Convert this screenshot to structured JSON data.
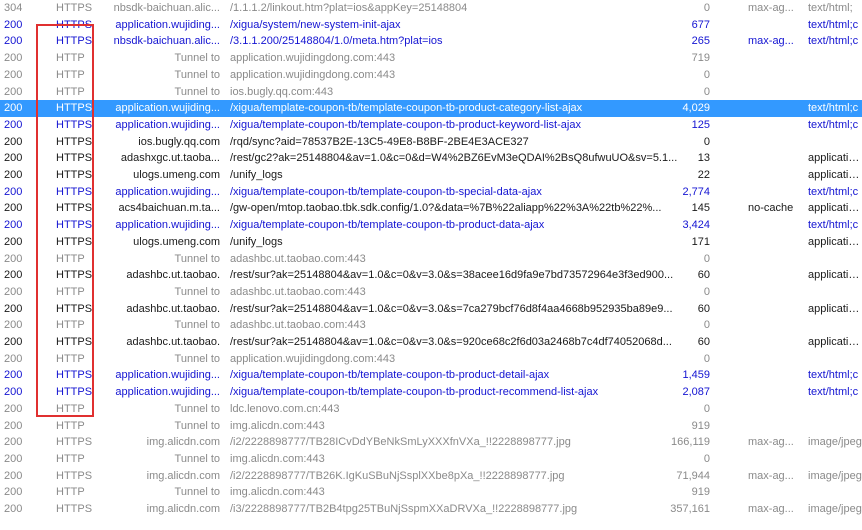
{
  "sessions": [
    {
      "result": "304",
      "protocol": "HTTPS",
      "host": "nbsdk-baichuan.alic...",
      "url": "/1.1.1.2/linkout.htm?plat=ios&appKey=25148804",
      "body": "0",
      "caching": "max-ag...",
      "content_type": "text/html;",
      "style": "gray"
    },
    {
      "result": "200",
      "protocol": "HTTPS",
      "host": "application.wujiding...",
      "url": "/xigua/system/new-system-init-ajax",
      "body": "677",
      "caching": "",
      "content_type": "text/html;c",
      "style": "blue"
    },
    {
      "result": "200",
      "protocol": "HTTPS",
      "host": "nbsdk-baichuan.alic...",
      "url": "/3.1.1.200/25148804/1.0/meta.htm?plat=ios",
      "body": "265",
      "caching": "max-ag...",
      "content_type": "text/html;c",
      "style": "blue"
    },
    {
      "result": "200",
      "protocol": "HTTP",
      "host": "Tunnel to",
      "url": "application.wujidingdong.com:443",
      "body": "719",
      "caching": "",
      "content_type": "",
      "style": "gray"
    },
    {
      "result": "200",
      "protocol": "HTTP",
      "host": "Tunnel to",
      "url": "application.wujidingdong.com:443",
      "body": "0",
      "caching": "",
      "content_type": "",
      "style": "gray"
    },
    {
      "result": "200",
      "protocol": "HTTP",
      "host": "Tunnel to",
      "url": "ios.bugly.qq.com:443",
      "body": "0",
      "caching": "",
      "content_type": "",
      "style": "gray"
    },
    {
      "result": "200",
      "protocol": "HTTPS",
      "host": "application.wujiding...",
      "url": "/xigua/template-coupon-tb/template-coupon-tb-product-category-list-ajax",
      "body": "4,029",
      "caching": "",
      "content_type": "text/html;c",
      "style": "selected"
    },
    {
      "result": "200",
      "protocol": "HTTPS",
      "host": "application.wujiding...",
      "url": "/xigua/template-coupon-tb/template-coupon-tb-product-keyword-list-ajax",
      "body": "125",
      "caching": "",
      "content_type": "text/html;c",
      "style": "blue"
    },
    {
      "result": "200",
      "protocol": "HTTPS",
      "host": "ios.bugly.qq.com",
      "url": "/rqd/sync?aid=78537B2E-13C5-49E8-B8BF-2BE4E3ACE327",
      "body": "0",
      "caching": "",
      "content_type": "",
      "style": "black"
    },
    {
      "result": "200",
      "protocol": "HTTPS",
      "host": "adashxgc.ut.taoba...",
      "url": "/rest/gc2?ak=25148804&av=1.0&c=0&d=W4%2BZ6EvM3eQDAI%2BsQ8ufwuUO&sv=5.1...",
      "body": "13",
      "caching": "",
      "content_type": "application/",
      "style": "black"
    },
    {
      "result": "200",
      "protocol": "HTTPS",
      "host": "ulogs.umeng.com",
      "url": "/unify_logs",
      "body": "22",
      "caching": "",
      "content_type": "application/",
      "style": "black"
    },
    {
      "result": "200",
      "protocol": "HTTPS",
      "host": "application.wujiding...",
      "url": "/xigua/template-coupon-tb/template-coupon-tb-special-data-ajax",
      "body": "2,774",
      "caching": "",
      "content_type": "text/html;c",
      "style": "blue"
    },
    {
      "result": "200",
      "protocol": "HTTPS",
      "host": "acs4baichuan.m.ta...",
      "url": "/gw-open/mtop.taobao.tbk.sdk.config/1.0?&data=%7B%22aliapp%22%3A%22tb%22%...",
      "body": "145",
      "caching": "no-cache",
      "content_type": "application/",
      "style": "black"
    },
    {
      "result": "200",
      "protocol": "HTTPS",
      "host": "application.wujiding...",
      "url": "/xigua/template-coupon-tb/template-coupon-tb-product-data-ajax",
      "body": "3,424",
      "caching": "",
      "content_type": "text/html;c",
      "style": "blue"
    },
    {
      "result": "200",
      "protocol": "HTTPS",
      "host": "ulogs.umeng.com",
      "url": "/unify_logs",
      "body": "171",
      "caching": "",
      "content_type": "application/",
      "style": "black"
    },
    {
      "result": "200",
      "protocol": "HTTP",
      "host": "Tunnel to",
      "url": "adashbc.ut.taobao.com:443",
      "body": "0",
      "caching": "",
      "content_type": "",
      "style": "gray"
    },
    {
      "result": "200",
      "protocol": "HTTPS",
      "host": "adashbc.ut.taobao.",
      "url": "/rest/sur?ak=25148804&av=1.0&c=0&v=3.0&s=38acee16d9fa9e7bd73572964e3f3ed900...",
      "body": "60",
      "caching": "",
      "content_type": "application/",
      "style": "black"
    },
    {
      "result": "200",
      "protocol": "HTTP",
      "host": "Tunnel to",
      "url": "adashbc.ut.taobao.com:443",
      "body": "0",
      "caching": "",
      "content_type": "",
      "style": "gray"
    },
    {
      "result": "200",
      "protocol": "HTTPS",
      "host": "adashbc.ut.taobao.",
      "url": "/rest/sur?ak=25148804&av=1.0&c=0&v=3.0&s=7ca279bcf76d8f4aa4668b952935ba89e9...",
      "body": "60",
      "caching": "",
      "content_type": "application/",
      "style": "black"
    },
    {
      "result": "200",
      "protocol": "HTTP",
      "host": "Tunnel to",
      "url": "adashbc.ut.taobao.com:443",
      "body": "0",
      "caching": "",
      "content_type": "",
      "style": "gray"
    },
    {
      "result": "200",
      "protocol": "HTTPS",
      "host": "adashbc.ut.taobao.",
      "url": "/rest/sur?ak=25148804&av=1.0&c=0&v=3.0&s=920ce68c2f6d03a2468b7c4df74052068d...",
      "body": "60",
      "caching": "",
      "content_type": "application/",
      "style": "black"
    },
    {
      "result": "200",
      "protocol": "HTTP",
      "host": "Tunnel to",
      "url": "application.wujidingdong.com:443",
      "body": "0",
      "caching": "",
      "content_type": "",
      "style": "gray"
    },
    {
      "result": "200",
      "protocol": "HTTPS",
      "host": "application.wujiding...",
      "url": "/xigua/template-coupon-tb/template-coupon-tb-product-detail-ajax",
      "body": "1,459",
      "caching": "",
      "content_type": "text/html;c",
      "style": "blue"
    },
    {
      "result": "200",
      "protocol": "HTTPS",
      "host": "application.wujiding...",
      "url": "/xigua/template-coupon-tb/template-coupon-tb-product-recommend-list-ajax",
      "body": "2,087",
      "caching": "",
      "content_type": "text/html;c",
      "style": "blue"
    },
    {
      "result": "200",
      "protocol": "HTTP",
      "host": "Tunnel to",
      "url": "ldc.lenovo.com.cn:443",
      "body": "0",
      "caching": "",
      "content_type": "",
      "style": "gray"
    },
    {
      "result": "200",
      "protocol": "HTTP",
      "host": "Tunnel to",
      "url": "img.alicdn.com:443",
      "body": "919",
      "caching": "",
      "content_type": "",
      "style": "gray"
    },
    {
      "result": "200",
      "protocol": "HTTPS",
      "host": "img.alicdn.com",
      "url": "/i2/2228898777/TB28ICvDdYBeNkSmLyXXXfnVXa_!!2228898777.jpg",
      "body": "166,119",
      "caching": "max-ag...",
      "content_type": "image/jpeg",
      "style": "gray"
    },
    {
      "result": "200",
      "protocol": "HTTP",
      "host": "Tunnel to",
      "url": "img.alicdn.com:443",
      "body": "0",
      "caching": "",
      "content_type": "",
      "style": "gray"
    },
    {
      "result": "200",
      "protocol": "HTTPS",
      "host": "img.alicdn.com",
      "url": "/i2/2228898777/TB26K.IgKuSBuNjSsplXXbe8pXa_!!2228898777.jpg",
      "body": "71,944",
      "caching": "max-ag...",
      "content_type": "image/jpeg",
      "style": "gray"
    },
    {
      "result": "200",
      "protocol": "HTTP",
      "host": "Tunnel to",
      "url": "img.alicdn.com:443",
      "body": "919",
      "caching": "",
      "content_type": "",
      "style": "gray"
    },
    {
      "result": "200",
      "protocol": "HTTPS",
      "host": "img.alicdn.com",
      "url": "/i3/2228898777/TB2B4tpg25TBuNjSspmXXaDRVXa_!!2228898777.jpg",
      "body": "357,161",
      "caching": "max-ag...",
      "content_type": "image/jpeg",
      "style": "gray"
    }
  ]
}
